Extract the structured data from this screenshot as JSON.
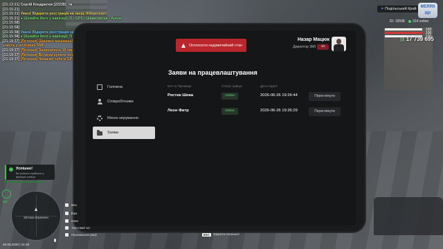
{
  "chat": [
    {
      "ts": "[21:13:21]",
      "text": "Сергій Кондратюк [22239]: ти",
      "color": "c-white"
    },
    {
      "ts": "[21:15:21]",
      "text": "",
      "color": "c-white"
    },
    {
      "ts": "[21:15:21]",
      "text": "Увага! Відкрита реєстрація на захід: Кіберспорт",
      "color": "c-yellow"
    },
    {
      "ts": "[21:15:21]",
      "text": "● Шукайте його у навігації: O - GPS - Цікаві місця - Арена",
      "color": "c-green"
    },
    {
      "ts": "[21:15:58]",
      "text": "",
      "color": "c-white"
    },
    {
      "ts": "[21:15:58]",
      "text": "",
      "color": "c-white"
    },
    {
      "ts": "[21:15:58]",
      "text": "Увага! Відкрита реєстрація на захід: Майстер дрифту!",
      "color": "c-cyan"
    },
    {
      "ts": "[21:15:58]",
      "text": "● Шукайте його у навігації: O - GPS - Цікаві місця - Арена",
      "color": "c-green"
    },
    {
      "ts": "[21:19:37]",
      "text": "[Лотерея] Шановні мешканці! Через 10 хвилин розпочнеться реєстрація на",
      "color": "c-orange"
    },
    {
      "ts": "",
      "text": "участь у розіграші SMI!",
      "color": "c-orange"
    },
    {
      "ts": "[21:19:37]",
      "text": "[Лотерея] Залишилось 10 хвилин до кінця розіграшу",
      "color": "c-orange"
    },
    {
      "ts": "[21:19:37]",
      "text": "[Лотерея] Встигни купити лотерейний квиток! Можливо ти станеш переможцем!",
      "color": "c-orange"
    },
    {
      "ts": "[21:19:37]",
      "text": "[Лотерея] Чекаємо тебе в GPS -> 'Цікаві місця' -> 'Казино'",
      "color": "c-orange"
    }
  ],
  "hud": {
    "server": "Подільський Край",
    "logo": "MERRII RP",
    "id_label": "ID: 19598",
    "online_label": "314 online",
    "bars": [
      {
        "value": 100,
        "label": "100",
        "color": "#ffffff"
      },
      {
        "value": 100,
        "label": "100",
        "color": "#d23a3a"
      },
      {
        "value": 100,
        "label": "100",
        "color": "#ffffff"
      }
    ],
    "money": "17 739 695"
  },
  "tablet": {
    "emergency_button": "Оголосити надзвичайний стан",
    "profile_name": "Назар Мацюк",
    "profile_role": "Директор ЗМІ",
    "profile_badge": "12",
    "section_title": "Заяви на працевлаштування",
    "menu": [
      {
        "label": "Головна",
        "icon": "home-icon",
        "active": false
      },
      {
        "label": "Співробітники",
        "icon": "users-icon",
        "active": false
      },
      {
        "label": "Меню керування",
        "icon": "gear-icon",
        "active": false
      },
      {
        "label": "Заяви",
        "icon": "folder-icon",
        "active": true
      }
    ],
    "table": {
      "headers": [
        "Ім'я та Прізвище",
        "Статус гравця",
        "Дата подачі"
      ],
      "rows": [
        {
          "name": "Ростик Шева",
          "status": "Online",
          "date": "2026-06-26 19:24:44",
          "action": "Переглянути"
        },
        {
          "name": "Леон Фитр",
          "status": "Online",
          "date": "2026-06-26 19:26:29",
          "action": "Переглянути"
        }
      ]
    }
  },
  "esc_hint": {
    "key": "ESC",
    "label": "Закрити планшет"
  },
  "notification": {
    "title": "Успішно!",
    "text": "Ви успішно прийняли у фракцію гравця."
  },
  "status_indicator": "GZ",
  "minimap": {
    "text": "Зв'язок втрачено"
  },
  "keyhints": [
    "Мен",
    "Віра",
    "Інвен",
    "Текстовий чат",
    "Перемикання рації"
  ],
  "datetime": "26.05.2026 | 21:20"
}
